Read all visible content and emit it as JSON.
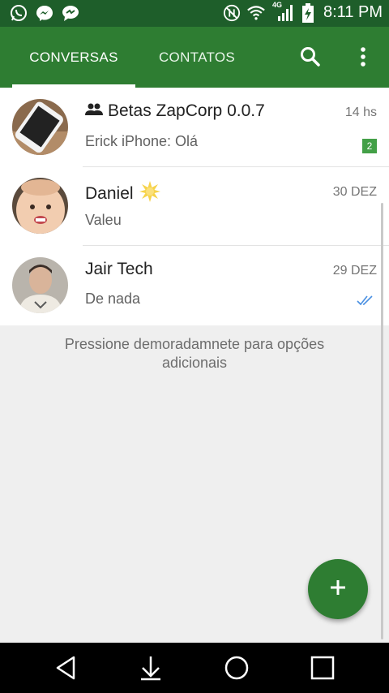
{
  "status_bar": {
    "time": "8:11 PM",
    "network_label": "4G",
    "left_icons": [
      "whatsapp-icon",
      "messenger-icon",
      "chat-bubble-icon"
    ],
    "right_icons": [
      "mute-icon",
      "wifi-icon",
      "signal-icon",
      "battery-charging-icon"
    ]
  },
  "tabs": [
    {
      "label": "CONVERSAS",
      "active": true
    },
    {
      "label": "CONTATOS",
      "active": false
    }
  ],
  "toolbar": {
    "icons": [
      "search-icon",
      "more-vert-icon"
    ]
  },
  "chats": [
    {
      "name": "Betas ZapCorp 0.0.7",
      "time": "14 hs",
      "message": "Erick iPhone: Olá",
      "unread": "2",
      "is_group": true
    },
    {
      "name": "Daniel",
      "time": "30 DEZ",
      "message": "Valeu",
      "has_emoji": true
    },
    {
      "name": "Jair Tech",
      "time": "29 DEZ",
      "message": "De nada",
      "read_receipt": "double-check-icon"
    }
  ],
  "hint": "Pressione demoradamnete para opções adicionais",
  "fab": {
    "icon": "plus-icon"
  },
  "nav_bar": {
    "icons": [
      "back-icon",
      "notification-pull-icon",
      "home-icon",
      "recents-icon"
    ]
  },
  "colors": {
    "primary": "#2e7d32",
    "status_bar": "#1e5e2a",
    "badge": "#43a047",
    "read_tick": "#4a90e2"
  }
}
